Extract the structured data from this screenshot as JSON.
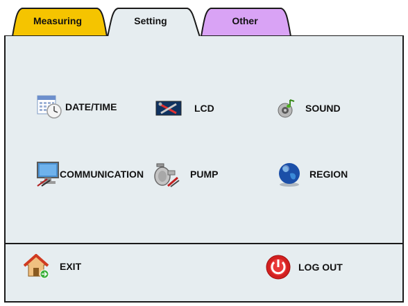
{
  "tabs": [
    {
      "label": "Measuring",
      "color": "#f5c400"
    },
    {
      "label": "Setting",
      "color": "#ffffff",
      "active": true
    },
    {
      "label": "Other",
      "color": "#d9a3f5"
    }
  ],
  "settings": {
    "date_time": {
      "label": "DATE/TIME",
      "icon": "calendar-clock-icon"
    },
    "lcd": {
      "label": "LCD",
      "icon": "lcd-tools-icon"
    },
    "sound": {
      "label": "SOUND",
      "icon": "speaker-icon"
    },
    "communication": {
      "label": "COMMUNICATION",
      "icon": "monitor-network-icon"
    },
    "pump": {
      "label": "PUMP",
      "icon": "pump-icon"
    },
    "region": {
      "label": "REGION",
      "icon": "globe-icon"
    }
  },
  "footer": {
    "exit": {
      "label": "EXIT",
      "icon": "home-icon"
    },
    "logout": {
      "label": "LOG OUT",
      "icon": "power-icon"
    }
  }
}
